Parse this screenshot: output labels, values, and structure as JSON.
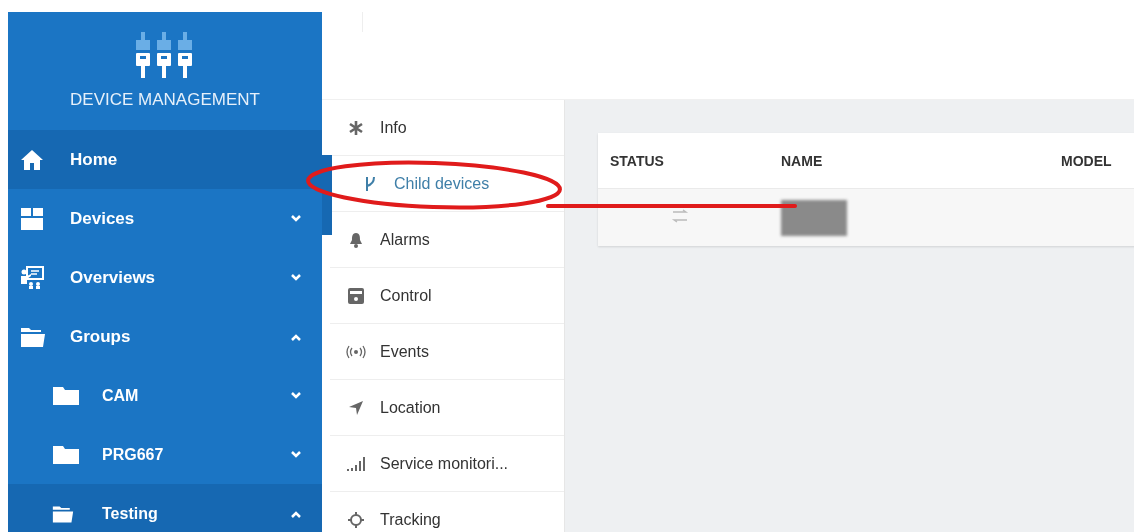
{
  "sidebar": {
    "title": "DEVICE MANAGEMENT",
    "items": [
      {
        "label": "Home",
        "kind": "link",
        "selected": true
      },
      {
        "label": "Devices",
        "kind": "group",
        "expanded": false,
        "selected": false
      },
      {
        "label": "Overviews",
        "kind": "group",
        "expanded": false,
        "selected": false
      },
      {
        "label": "Groups",
        "kind": "group",
        "expanded": true,
        "selected": false,
        "children": [
          {
            "label": "CAM",
            "kind": "group",
            "expanded": false,
            "selected": false
          },
          {
            "label": "PRG667",
            "kind": "group",
            "expanded": false,
            "selected": false
          },
          {
            "label": "Testing",
            "kind": "group",
            "expanded": true,
            "selected": true
          }
        ]
      }
    ]
  },
  "submenu": {
    "items": [
      {
        "label": "Info",
        "selected": false
      },
      {
        "label": "Child devices",
        "selected": true
      },
      {
        "label": "Alarms",
        "selected": false
      },
      {
        "label": "Control",
        "selected": false
      },
      {
        "label": "Events",
        "selected": false
      },
      {
        "label": "Location",
        "selected": false
      },
      {
        "label": "Service monitori...",
        "selected": false
      },
      {
        "label": "Tracking",
        "selected": false
      }
    ]
  },
  "table": {
    "columns": [
      "STATUS",
      "NAME",
      "MODEL"
    ],
    "rows": [
      {
        "kind": "redacted"
      }
    ]
  },
  "annotation": {
    "kind": "circle-and-line"
  }
}
